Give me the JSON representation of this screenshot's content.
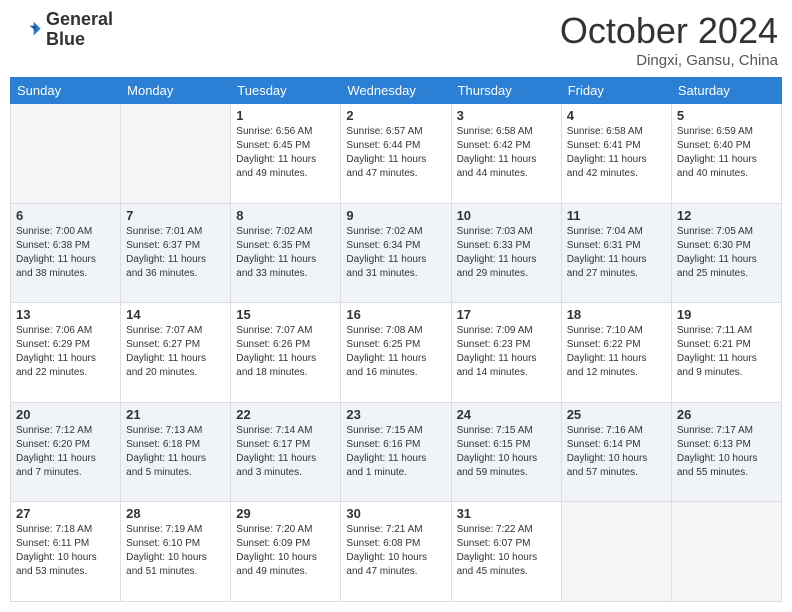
{
  "logo": {
    "line1": "General",
    "line2": "Blue"
  },
  "header": {
    "title": "October 2024",
    "subtitle": "Dingxi, Gansu, China"
  },
  "weekdays": [
    "Sunday",
    "Monday",
    "Tuesday",
    "Wednesday",
    "Thursday",
    "Friday",
    "Saturday"
  ],
  "weeks": [
    [
      {
        "day": "",
        "sunrise": "",
        "sunset": "",
        "daylight": "",
        "empty": true
      },
      {
        "day": "",
        "sunrise": "",
        "sunset": "",
        "daylight": "",
        "empty": true
      },
      {
        "day": "1",
        "sunrise": "Sunrise: 6:56 AM",
        "sunset": "Sunset: 6:45 PM",
        "daylight": "Daylight: 11 hours and 49 minutes."
      },
      {
        "day": "2",
        "sunrise": "Sunrise: 6:57 AM",
        "sunset": "Sunset: 6:44 PM",
        "daylight": "Daylight: 11 hours and 47 minutes."
      },
      {
        "day": "3",
        "sunrise": "Sunrise: 6:58 AM",
        "sunset": "Sunset: 6:42 PM",
        "daylight": "Daylight: 11 hours and 44 minutes."
      },
      {
        "day": "4",
        "sunrise": "Sunrise: 6:58 AM",
        "sunset": "Sunset: 6:41 PM",
        "daylight": "Daylight: 11 hours and 42 minutes."
      },
      {
        "day": "5",
        "sunrise": "Sunrise: 6:59 AM",
        "sunset": "Sunset: 6:40 PM",
        "daylight": "Daylight: 11 hours and 40 minutes."
      }
    ],
    [
      {
        "day": "6",
        "sunrise": "Sunrise: 7:00 AM",
        "sunset": "Sunset: 6:38 PM",
        "daylight": "Daylight: 11 hours and 38 minutes."
      },
      {
        "day": "7",
        "sunrise": "Sunrise: 7:01 AM",
        "sunset": "Sunset: 6:37 PM",
        "daylight": "Daylight: 11 hours and 36 minutes."
      },
      {
        "day": "8",
        "sunrise": "Sunrise: 7:02 AM",
        "sunset": "Sunset: 6:35 PM",
        "daylight": "Daylight: 11 hours and 33 minutes."
      },
      {
        "day": "9",
        "sunrise": "Sunrise: 7:02 AM",
        "sunset": "Sunset: 6:34 PM",
        "daylight": "Daylight: 11 hours and 31 minutes."
      },
      {
        "day": "10",
        "sunrise": "Sunrise: 7:03 AM",
        "sunset": "Sunset: 6:33 PM",
        "daylight": "Daylight: 11 hours and 29 minutes."
      },
      {
        "day": "11",
        "sunrise": "Sunrise: 7:04 AM",
        "sunset": "Sunset: 6:31 PM",
        "daylight": "Daylight: 11 hours and 27 minutes."
      },
      {
        "day": "12",
        "sunrise": "Sunrise: 7:05 AM",
        "sunset": "Sunset: 6:30 PM",
        "daylight": "Daylight: 11 hours and 25 minutes."
      }
    ],
    [
      {
        "day": "13",
        "sunrise": "Sunrise: 7:06 AM",
        "sunset": "Sunset: 6:29 PM",
        "daylight": "Daylight: 11 hours and 22 minutes."
      },
      {
        "day": "14",
        "sunrise": "Sunrise: 7:07 AM",
        "sunset": "Sunset: 6:27 PM",
        "daylight": "Daylight: 11 hours and 20 minutes."
      },
      {
        "day": "15",
        "sunrise": "Sunrise: 7:07 AM",
        "sunset": "Sunset: 6:26 PM",
        "daylight": "Daylight: 11 hours and 18 minutes."
      },
      {
        "day": "16",
        "sunrise": "Sunrise: 7:08 AM",
        "sunset": "Sunset: 6:25 PM",
        "daylight": "Daylight: 11 hours and 16 minutes."
      },
      {
        "day": "17",
        "sunrise": "Sunrise: 7:09 AM",
        "sunset": "Sunset: 6:23 PM",
        "daylight": "Daylight: 11 hours and 14 minutes."
      },
      {
        "day": "18",
        "sunrise": "Sunrise: 7:10 AM",
        "sunset": "Sunset: 6:22 PM",
        "daylight": "Daylight: 11 hours and 12 minutes."
      },
      {
        "day": "19",
        "sunrise": "Sunrise: 7:11 AM",
        "sunset": "Sunset: 6:21 PM",
        "daylight": "Daylight: 11 hours and 9 minutes."
      }
    ],
    [
      {
        "day": "20",
        "sunrise": "Sunrise: 7:12 AM",
        "sunset": "Sunset: 6:20 PM",
        "daylight": "Daylight: 11 hours and 7 minutes."
      },
      {
        "day": "21",
        "sunrise": "Sunrise: 7:13 AM",
        "sunset": "Sunset: 6:18 PM",
        "daylight": "Daylight: 11 hours and 5 minutes."
      },
      {
        "day": "22",
        "sunrise": "Sunrise: 7:14 AM",
        "sunset": "Sunset: 6:17 PM",
        "daylight": "Daylight: 11 hours and 3 minutes."
      },
      {
        "day": "23",
        "sunrise": "Sunrise: 7:15 AM",
        "sunset": "Sunset: 6:16 PM",
        "daylight": "Daylight: 11 hours and 1 minute."
      },
      {
        "day": "24",
        "sunrise": "Sunrise: 7:15 AM",
        "sunset": "Sunset: 6:15 PM",
        "daylight": "Daylight: 10 hours and 59 minutes."
      },
      {
        "day": "25",
        "sunrise": "Sunrise: 7:16 AM",
        "sunset": "Sunset: 6:14 PM",
        "daylight": "Daylight: 10 hours and 57 minutes."
      },
      {
        "day": "26",
        "sunrise": "Sunrise: 7:17 AM",
        "sunset": "Sunset: 6:13 PM",
        "daylight": "Daylight: 10 hours and 55 minutes."
      }
    ],
    [
      {
        "day": "27",
        "sunrise": "Sunrise: 7:18 AM",
        "sunset": "Sunset: 6:11 PM",
        "daylight": "Daylight: 10 hours and 53 minutes."
      },
      {
        "day": "28",
        "sunrise": "Sunrise: 7:19 AM",
        "sunset": "Sunset: 6:10 PM",
        "daylight": "Daylight: 10 hours and 51 minutes."
      },
      {
        "day": "29",
        "sunrise": "Sunrise: 7:20 AM",
        "sunset": "Sunset: 6:09 PM",
        "daylight": "Daylight: 10 hours and 49 minutes."
      },
      {
        "day": "30",
        "sunrise": "Sunrise: 7:21 AM",
        "sunset": "Sunset: 6:08 PM",
        "daylight": "Daylight: 10 hours and 47 minutes."
      },
      {
        "day": "31",
        "sunrise": "Sunrise: 7:22 AM",
        "sunset": "Sunset: 6:07 PM",
        "daylight": "Daylight: 10 hours and 45 minutes."
      },
      {
        "day": "",
        "sunrise": "",
        "sunset": "",
        "daylight": "",
        "empty": true
      },
      {
        "day": "",
        "sunrise": "",
        "sunset": "",
        "daylight": "",
        "empty": true
      }
    ]
  ]
}
